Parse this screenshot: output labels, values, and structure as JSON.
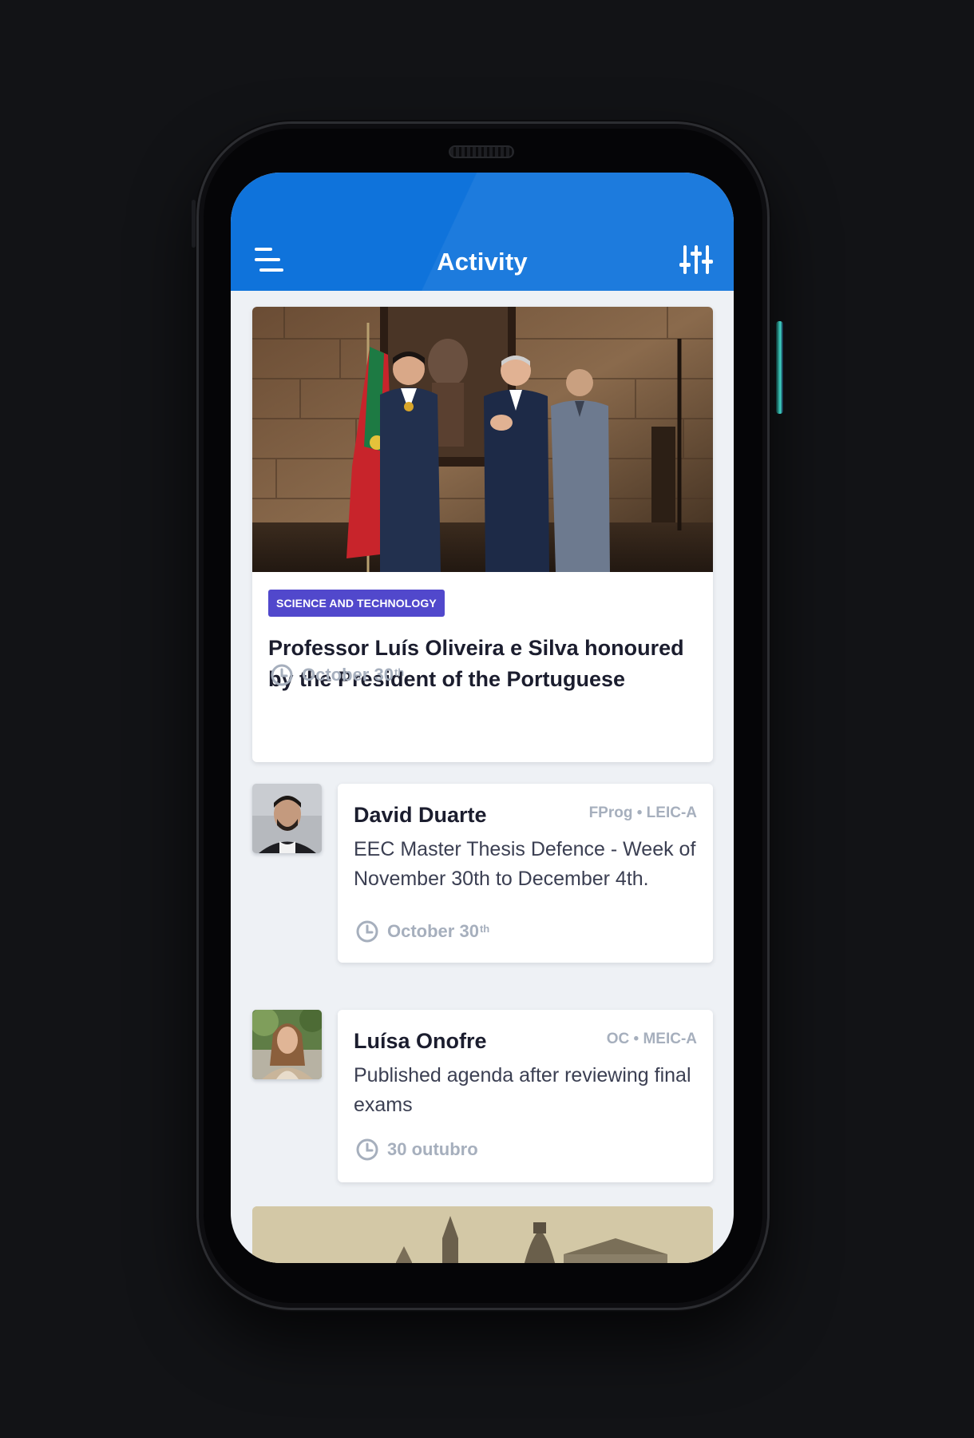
{
  "header": {
    "title": "Activity",
    "menu_icon": "menu-icon",
    "filter_icon": "sliders-icon",
    "color": "#0f73db"
  },
  "feature": {
    "category": "SCIENCE AND TECHNOLOGY",
    "category_color": "#5148cc",
    "title": "Professor Luís Oliveira e Silva honoured by the President of the Portuguese",
    "date": "October 30",
    "date_suffix": "th",
    "photo": "ceremony-photo"
  },
  "posts": [
    {
      "author": "David Duarte",
      "course": "FProg • LEIC-A",
      "text": "EEC Master Thesis Defence - Week of November 30th to December 4th.",
      "date": "October 30",
      "date_suffix": "th"
    },
    {
      "author": "Luísa Onofre",
      "course": "OC • MEIC-A",
      "text": "Published agenda after reviewing final exams",
      "date": "30 outubro",
      "date_suffix": ""
    }
  ]
}
